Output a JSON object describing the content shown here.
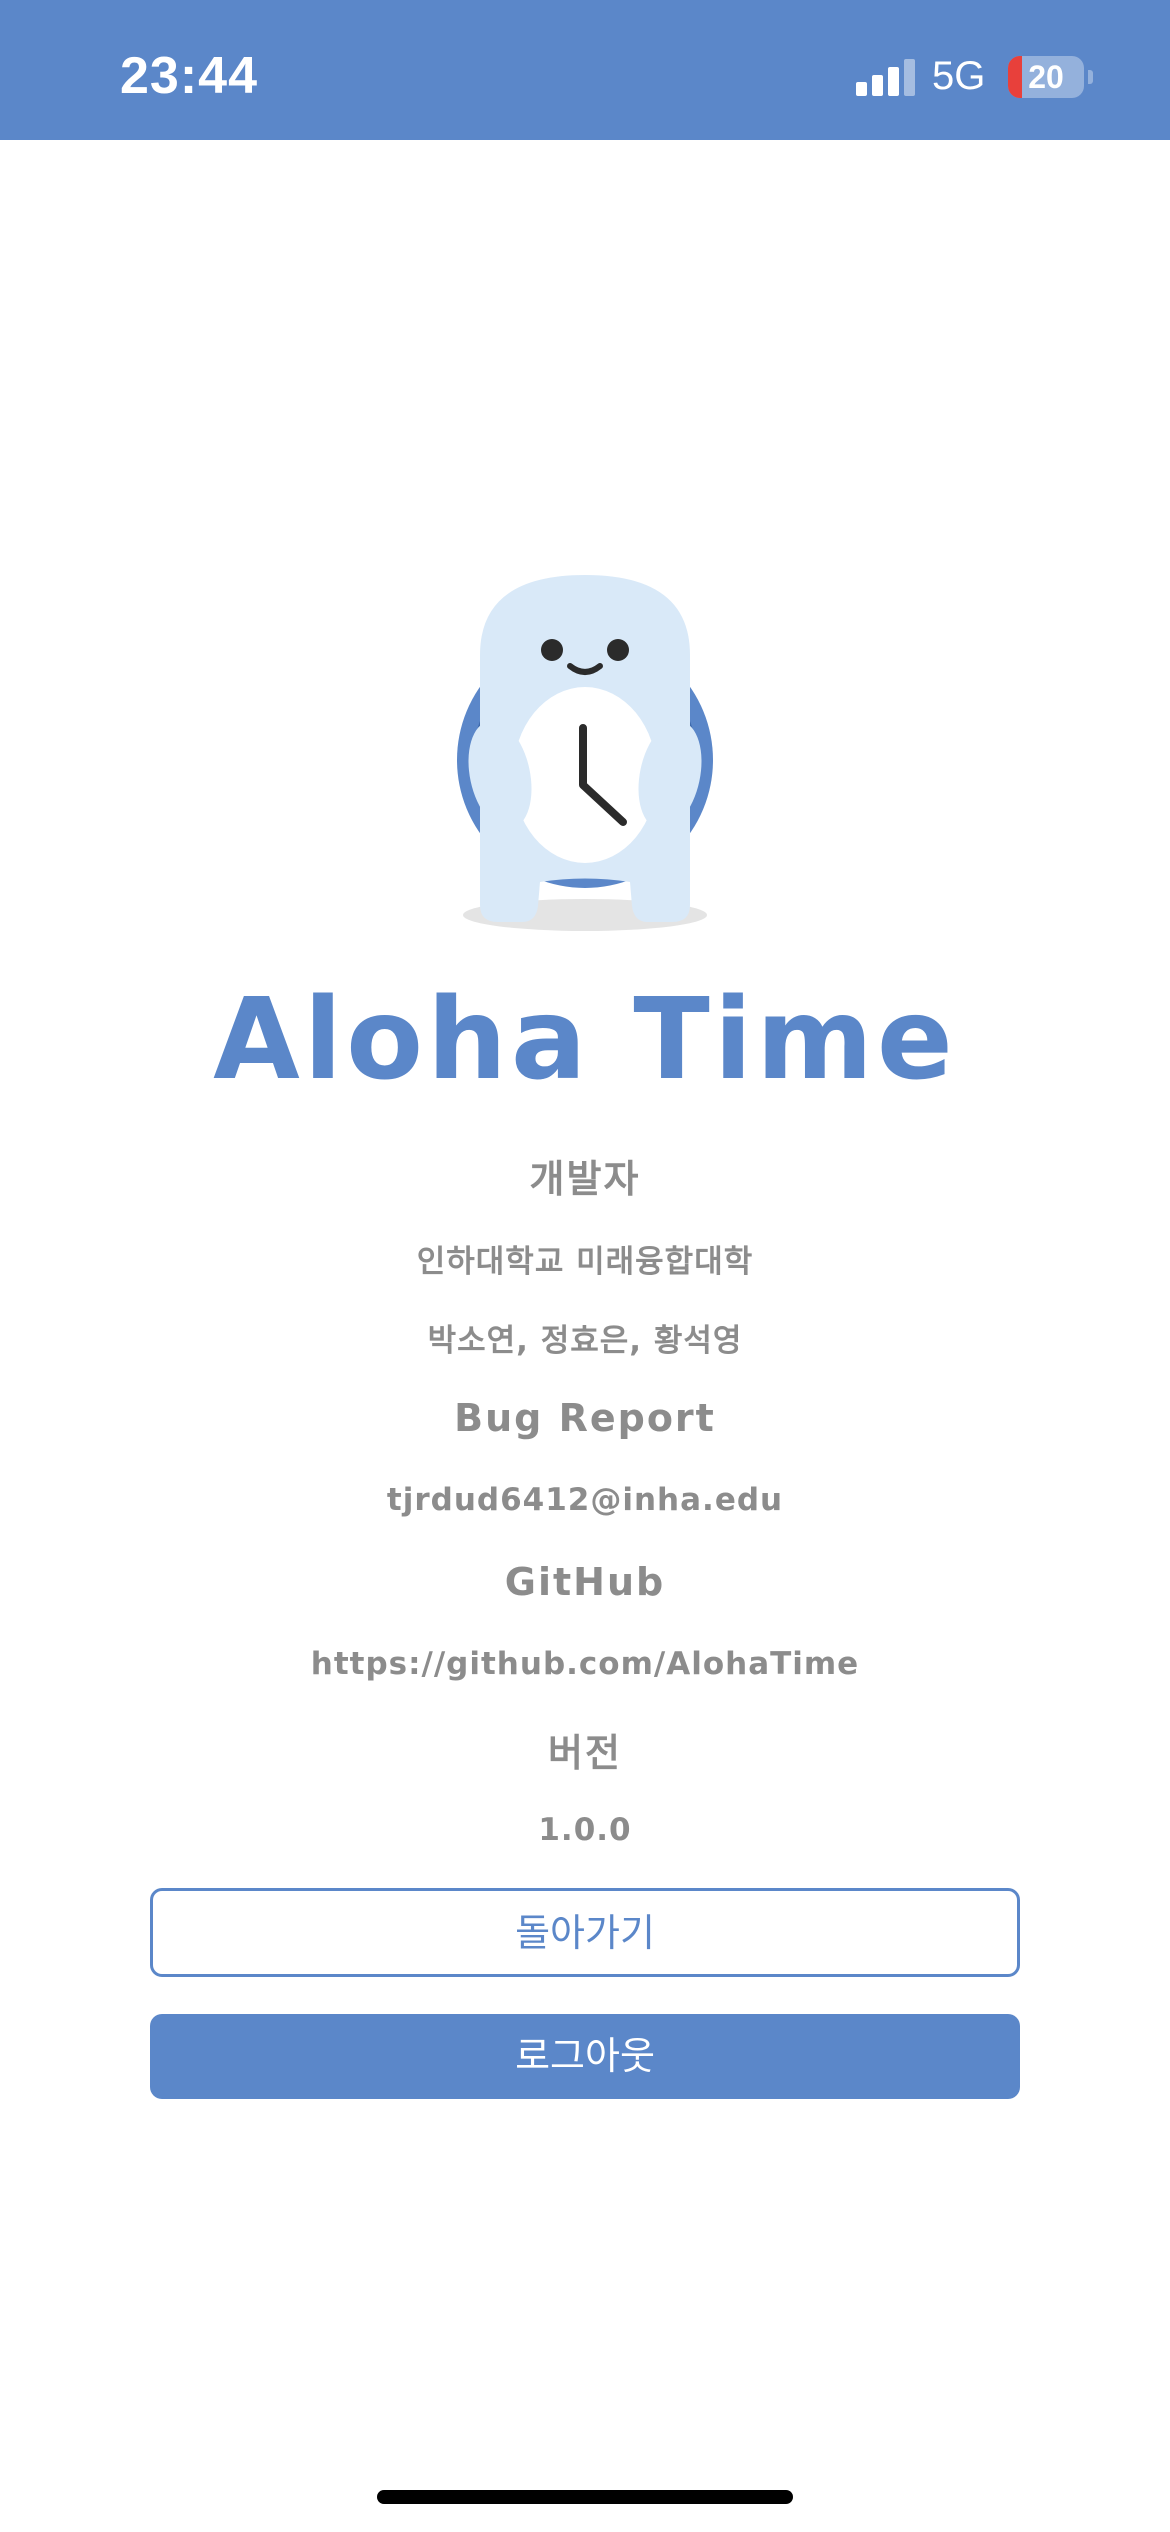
{
  "status_bar": {
    "time": "23:44",
    "network": "5G",
    "battery_level": "20",
    "signal_icon": "cellular-signal-icon",
    "battery_icon": "battery-icon"
  },
  "app": {
    "title": "Aloha Time",
    "mascot_icon": "aloha-clock-mascot-icon"
  },
  "info": {
    "developer_heading": "개발자",
    "school": "인하대학교 미래융합대학",
    "developers": "박소연, 정효은, 황석영",
    "bug_report_heading": "Bug Report",
    "bug_report_email": "tjrdud6412@inha.edu",
    "github_heading": "GitHub",
    "github_url": "https://github.com/AlohaTime",
    "version_heading": "버전",
    "version_value": "1.0.0"
  },
  "buttons": {
    "back_label": "돌아가기",
    "logout_label": "로그아웃"
  },
  "colors": {
    "primary": "#5b87c9",
    "text_gray": "#8c8c8c",
    "battery_low": "#e8403b"
  }
}
